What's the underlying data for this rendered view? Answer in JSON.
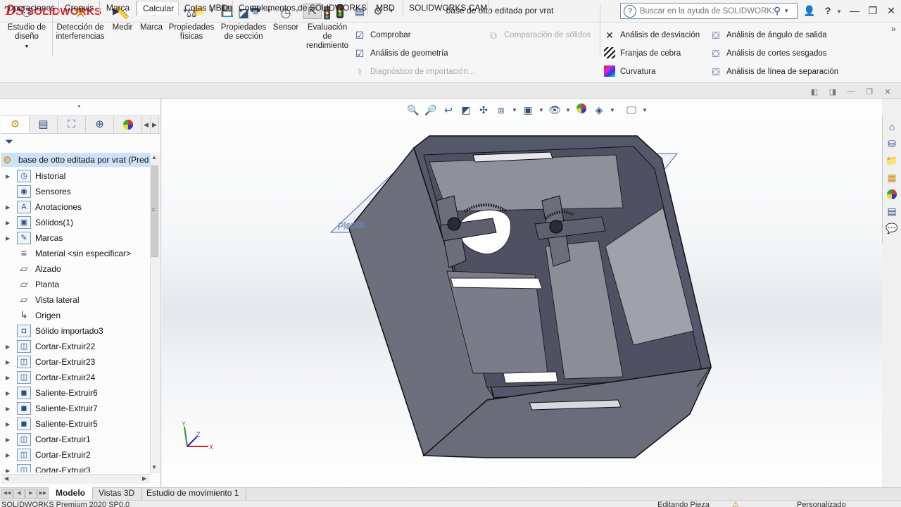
{
  "app": {
    "logo_ds": "𝔇𝔖",
    "logo_name": "SOLIDWORKS",
    "document_title": "base de otto editada por vrat"
  },
  "help_search": {
    "placeholder": "Buscar en la ayuda de SOLIDWORKS"
  },
  "ribbon": {
    "big_buttons": [
      {
        "label_line1": "Estudio de",
        "label_line2": "diseño"
      },
      {
        "label_line1": "Detección de",
        "label_line2": "interferencias"
      },
      {
        "label_line1": "Medir",
        "label_line2": ""
      },
      {
        "label_line1": "Marca",
        "label_line2": ""
      },
      {
        "label_line1": "Propiedades",
        "label_line2": "físicas"
      },
      {
        "label_line1": "Propiedades",
        "label_line2": "de sección"
      },
      {
        "label_line1": "Sensor",
        "label_line2": ""
      },
      {
        "label_line1": "Evaluación",
        "label_line2": "de",
        "label_line3": "rendimiento"
      }
    ],
    "col1": [
      {
        "label": "Comprobar",
        "disabled": false
      },
      {
        "label": "Análisis de geometría",
        "disabled": false
      },
      {
        "label": "Diagnóstico de importación...",
        "disabled": true
      }
    ],
    "col2": [
      {
        "label": "Comparación de sólidos",
        "disabled": true
      }
    ],
    "col3": [
      {
        "label": "Análisis de desviación"
      },
      {
        "label": "Franjas de cebra"
      },
      {
        "label": "Curvatura"
      }
    ],
    "col4": [
      {
        "label": "Análisis de ángulo de salida"
      },
      {
        "label": "Análisis de cortes sesgados"
      },
      {
        "label": "Análisis de línea de separación"
      }
    ]
  },
  "command_tabs": [
    "Operaciones",
    "Croquis",
    "Marca",
    "Calcular",
    "Cotas MBD",
    "Complementos de SOLIDWORKS",
    "MBD",
    "SOLIDWORKS CAM"
  ],
  "active_command_tab": "Calcular",
  "feature_tree": {
    "root": "base de otto editada por vrat  (Pred",
    "items": [
      {
        "label": "Historial",
        "icon": "history-icon",
        "expandable": true
      },
      {
        "label": "Sensores",
        "icon": "sensor-icon",
        "expandable": false
      },
      {
        "label": "Anotaciones",
        "icon": "annotation-icon",
        "expandable": true
      },
      {
        "label": "Sólidos(1)",
        "icon": "solid-bodies-icon",
        "expandable": true
      },
      {
        "label": "Marcas",
        "icon": "marks-icon",
        "expandable": true
      },
      {
        "label": "Material <sin especificar>",
        "icon": "material-icon",
        "expandable": false
      },
      {
        "label": "Alzado",
        "icon": "plane-icon",
        "expandable": false
      },
      {
        "label": "Planta",
        "icon": "plane-icon",
        "expandable": false
      },
      {
        "label": "Vista lateral",
        "icon": "plane-icon",
        "expandable": false
      },
      {
        "label": "Origen",
        "icon": "origin-icon",
        "expandable": false
      },
      {
        "label": "Sólido importado3",
        "icon": "imported-solid-icon",
        "expandable": false
      },
      {
        "label": "Cortar-Extruir22",
        "icon": "cut-extrude-icon",
        "expandable": true
      },
      {
        "label": "Cortar-Extruir23",
        "icon": "cut-extrude-icon",
        "expandable": true
      },
      {
        "label": "Cortar-Extruir24",
        "icon": "cut-extrude-icon",
        "expandable": true
      },
      {
        "label": "Saliente-Extruir6",
        "icon": "boss-extrude-icon",
        "expandable": true
      },
      {
        "label": "Saliente-Extruir7",
        "icon": "boss-extrude-icon",
        "expandable": true
      },
      {
        "label": "Saliente-Extruir5",
        "icon": "boss-extrude-icon",
        "expandable": true
      },
      {
        "label": "Cortar-Extruir1",
        "icon": "cut-extrude-icon",
        "expandable": true
      },
      {
        "label": "Cortar-Extruir2",
        "icon": "cut-extrude-icon",
        "expandable": true
      },
      {
        "label": "Cortar-Extruir3",
        "icon": "cut-extrude-icon",
        "expandable": true
      }
    ]
  },
  "viewport": {
    "plane_label": "Planta"
  },
  "triad": {
    "x": "X",
    "y": "Y",
    "z": "Z"
  },
  "bottom_tabs": [
    "Modelo",
    "Vistas 3D",
    "Estudio de movimiento 1"
  ],
  "active_bottom_tab": "Modelo",
  "status": {
    "left": "SOLIDWORKS Premium 2020 SP0.0",
    "middle": "Editando Pieza",
    "right": "Personalizado"
  },
  "colors": {
    "accent": "#2f4f7f",
    "brand_red": "#d8232a",
    "selection": "#cce2f7",
    "model_gray": "#5e6070"
  }
}
